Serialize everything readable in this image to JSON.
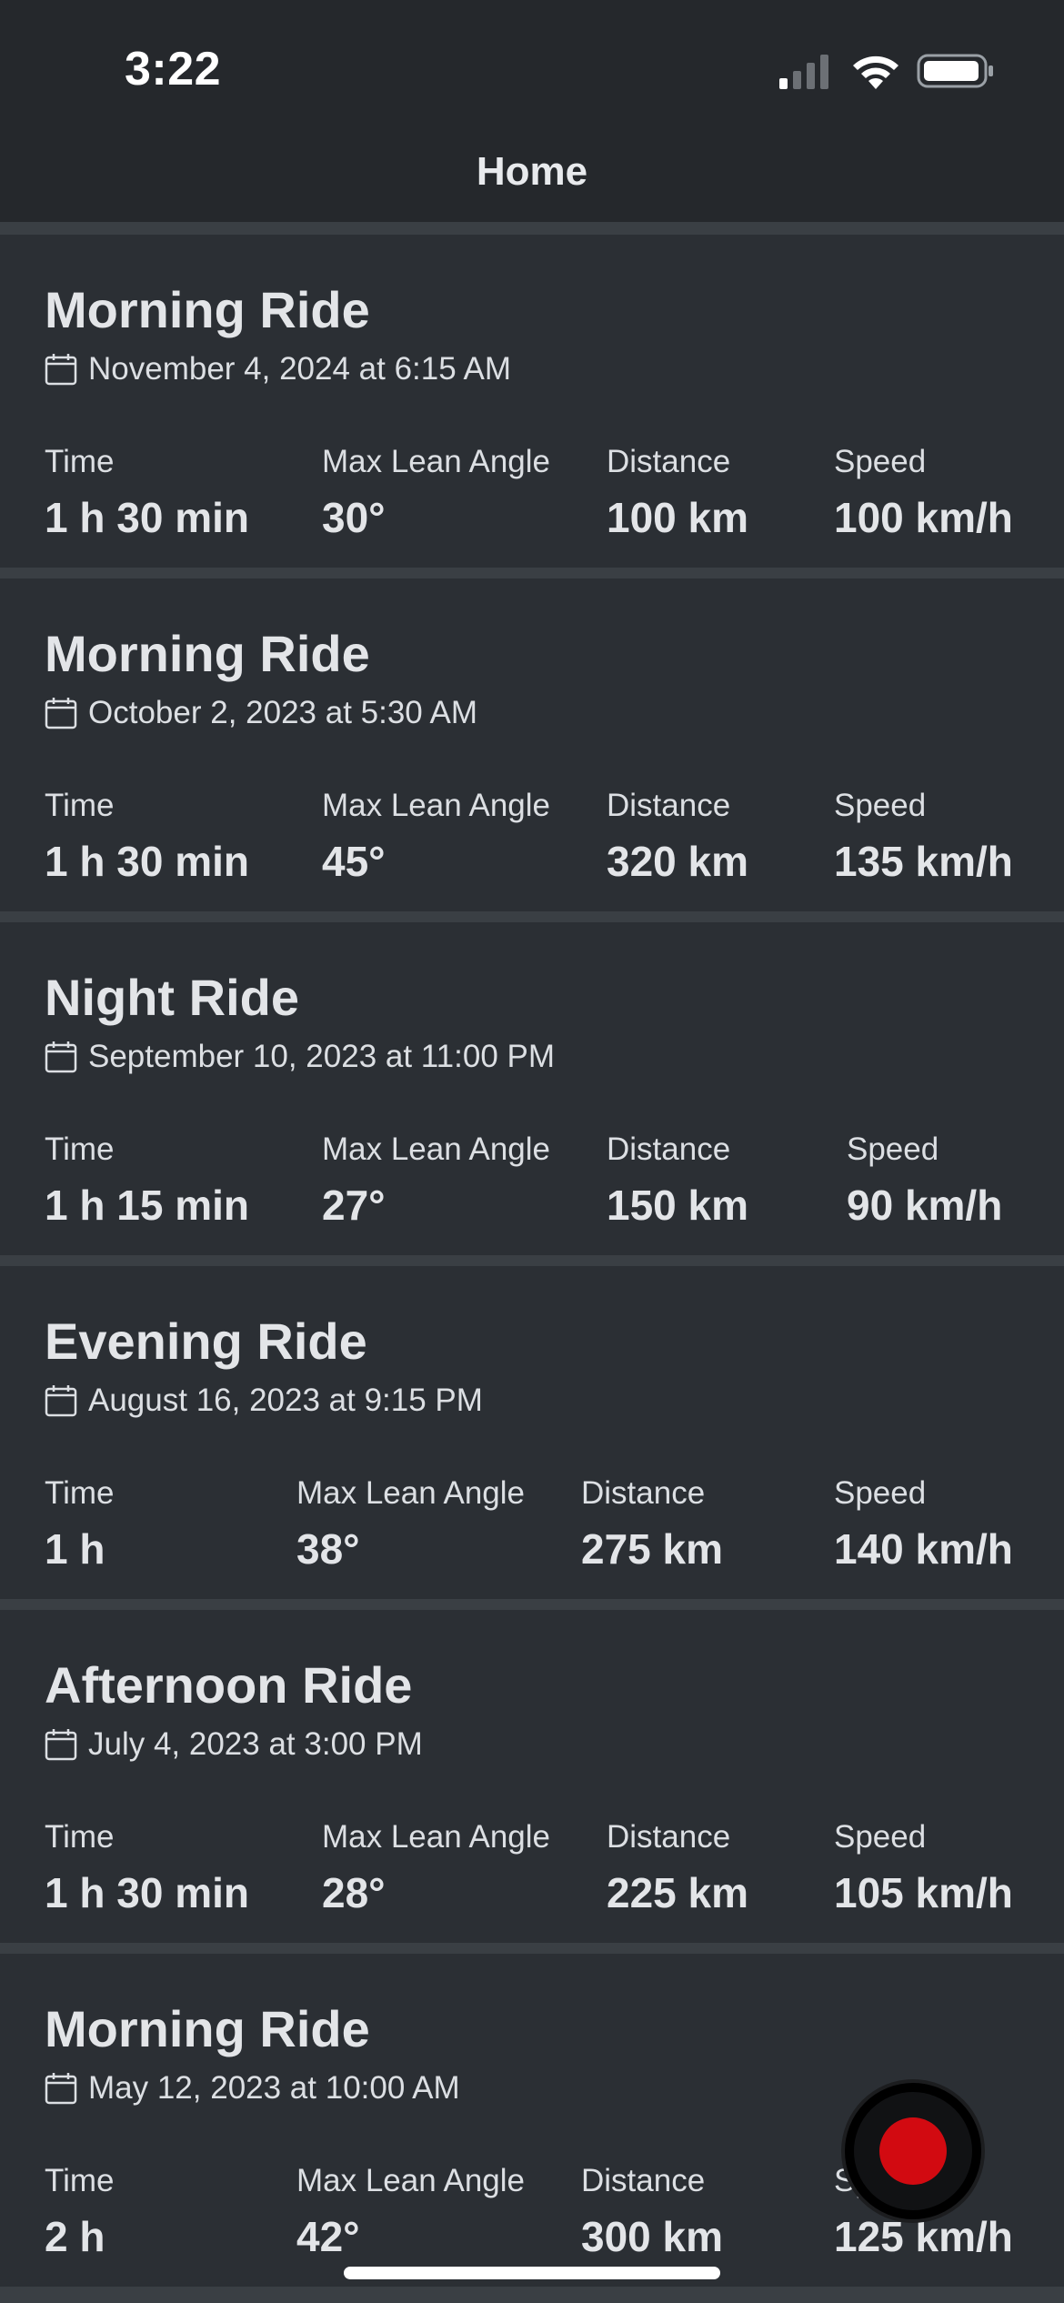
{
  "status_bar": {
    "time": "3:22",
    "icons": [
      "cellular-signal-icon",
      "wifi-icon",
      "battery-icon"
    ]
  },
  "header": {
    "title": "Home"
  },
  "rides": [
    {
      "title": "Morning Ride",
      "date": "November 4, 2024 at 6:15 AM",
      "stats": [
        {
          "label": "Time",
          "value": "1 h 30 min"
        },
        {
          "label": "Max Lean Angle",
          "value": "30°"
        },
        {
          "label": "Distance",
          "value": "100 km"
        },
        {
          "label": "Speed",
          "value": "100 km/h"
        }
      ]
    },
    {
      "title": "Morning Ride",
      "date": "October 2, 2023 at 5:30 AM",
      "stats": [
        {
          "label": "Time",
          "value": "1 h 30 min"
        },
        {
          "label": "Max Lean Angle",
          "value": "45°"
        },
        {
          "label": "Distance",
          "value": "320 km"
        },
        {
          "label": "Speed",
          "value": "135 km/h"
        }
      ]
    },
    {
      "title": "Night Ride",
      "date": "September 10, 2023 at 11:00 PM",
      "stats": [
        {
          "label": "Time",
          "value": "1 h 15 min"
        },
        {
          "label": "Max Lean Angle",
          "value": "27°"
        },
        {
          "label": "Distance",
          "value": "150 km"
        },
        {
          "label": "Speed",
          "value": "90 km/h"
        }
      ]
    },
    {
      "title": "Evening Ride",
      "date": "August 16, 2023 at 9:15 PM",
      "stats": [
        {
          "label": "Time",
          "value": "1 h"
        },
        {
          "label": "Max Lean Angle",
          "value": "38°"
        },
        {
          "label": "Distance",
          "value": "275 km"
        },
        {
          "label": "Speed",
          "value": "140 km/h"
        }
      ]
    },
    {
      "title": "Afternoon Ride",
      "date": "July 4, 2023 at 3:00 PM",
      "stats": [
        {
          "label": "Time",
          "value": "1 h 30 min"
        },
        {
          "label": "Max Lean Angle",
          "value": "28°"
        },
        {
          "label": "Distance",
          "value": "225 km"
        },
        {
          "label": "Speed",
          "value": "105 km/h"
        }
      ]
    },
    {
      "title": "Morning Ride",
      "date": "May 12, 2023 at 10:00 AM",
      "stats": [
        {
          "label": "Time",
          "value": "2 h"
        },
        {
          "label": "Max Lean Angle",
          "value": "42°"
        },
        {
          "label": "Distance",
          "value": "300 km"
        },
        {
          "label": "Speed",
          "value": "125 km/h"
        }
      ]
    }
  ],
  "record_button": {
    "icon": "record-icon",
    "color": "#d20a11"
  },
  "colors": {
    "background": "#3a3f44",
    "card": "#2b2f34",
    "header": "#25282c",
    "text": "#e3e5e8"
  }
}
